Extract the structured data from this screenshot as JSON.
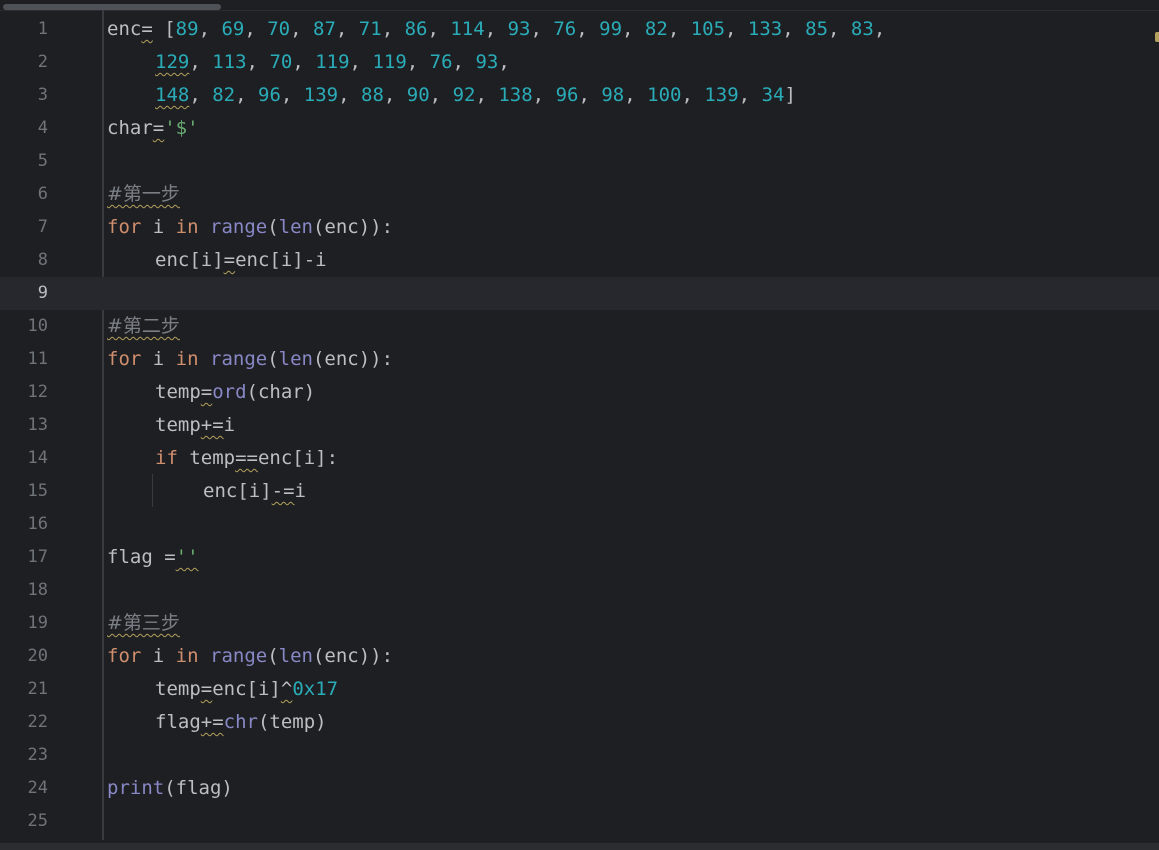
{
  "editor": {
    "lines": [
      {
        "n": "1",
        "t": [
          {
            "v": "enc",
            "c": ""
          },
          {
            "v": "=",
            "c": "",
            "w": true
          },
          {
            "v": " [",
            "c": ""
          },
          {
            "v": "89",
            "c": "num"
          },
          {
            "v": ", ",
            "c": ""
          },
          {
            "v": "69",
            "c": "num"
          },
          {
            "v": ", ",
            "c": ""
          },
          {
            "v": "70",
            "c": "num"
          },
          {
            "v": ", ",
            "c": ""
          },
          {
            "v": "87",
            "c": "num"
          },
          {
            "v": ", ",
            "c": ""
          },
          {
            "v": "71",
            "c": "num"
          },
          {
            "v": ", ",
            "c": ""
          },
          {
            "v": "86",
            "c": "num"
          },
          {
            "v": ", ",
            "c": ""
          },
          {
            "v": "114",
            "c": "num"
          },
          {
            "v": ", ",
            "c": ""
          },
          {
            "v": "93",
            "c": "num"
          },
          {
            "v": ", ",
            "c": ""
          },
          {
            "v": "76",
            "c": "num"
          },
          {
            "v": ", ",
            "c": ""
          },
          {
            "v": "99",
            "c": "num"
          },
          {
            "v": ", ",
            "c": ""
          },
          {
            "v": "82",
            "c": "num"
          },
          {
            "v": ", ",
            "c": ""
          },
          {
            "v": "105",
            "c": "num"
          },
          {
            "v": ", ",
            "c": ""
          },
          {
            "v": "133",
            "c": "num"
          },
          {
            "v": ", ",
            "c": ""
          },
          {
            "v": "85",
            "c": "num"
          },
          {
            "v": ", ",
            "c": ""
          },
          {
            "v": "83",
            "c": "num"
          },
          {
            "v": ",",
            "c": ""
          }
        ]
      },
      {
        "n": "2",
        "i": 1,
        "t": [
          {
            "v": "129",
            "c": "num",
            "w": true
          },
          {
            "v": ", ",
            "c": ""
          },
          {
            "v": "113",
            "c": "num"
          },
          {
            "v": ", ",
            "c": ""
          },
          {
            "v": "70",
            "c": "num"
          },
          {
            "v": ", ",
            "c": ""
          },
          {
            "v": "119",
            "c": "num"
          },
          {
            "v": ", ",
            "c": ""
          },
          {
            "v": "119",
            "c": "num"
          },
          {
            "v": ", ",
            "c": ""
          },
          {
            "v": "76",
            "c": "num"
          },
          {
            "v": ", ",
            "c": ""
          },
          {
            "v": "93",
            "c": "num"
          },
          {
            "v": ",",
            "c": ""
          }
        ]
      },
      {
        "n": "3",
        "i": 1,
        "t": [
          {
            "v": "148",
            "c": "num",
            "w": true
          },
          {
            "v": ", ",
            "c": ""
          },
          {
            "v": "82",
            "c": "num"
          },
          {
            "v": ", ",
            "c": ""
          },
          {
            "v": "96",
            "c": "num"
          },
          {
            "v": ", ",
            "c": ""
          },
          {
            "v": "139",
            "c": "num"
          },
          {
            "v": ", ",
            "c": ""
          },
          {
            "v": "88",
            "c": "num"
          },
          {
            "v": ", ",
            "c": ""
          },
          {
            "v": "90",
            "c": "num"
          },
          {
            "v": ", ",
            "c": ""
          },
          {
            "v": "92",
            "c": "num"
          },
          {
            "v": ", ",
            "c": ""
          },
          {
            "v": "138",
            "c": "num"
          },
          {
            "v": ", ",
            "c": ""
          },
          {
            "v": "96",
            "c": "num"
          },
          {
            "v": ", ",
            "c": ""
          },
          {
            "v": "98",
            "c": "num"
          },
          {
            "v": ", ",
            "c": ""
          },
          {
            "v": "100",
            "c": "num"
          },
          {
            "v": ", ",
            "c": ""
          },
          {
            "v": "139",
            "c": "num"
          },
          {
            "v": ", ",
            "c": ""
          },
          {
            "v": "34",
            "c": "num"
          },
          {
            "v": "]",
            "c": ""
          }
        ]
      },
      {
        "n": "4",
        "t": [
          {
            "v": "char",
            "c": ""
          },
          {
            "v": "=",
            "c": "",
            "w": true
          },
          {
            "v": "'$'",
            "c": "str"
          }
        ]
      },
      {
        "n": "5",
        "t": []
      },
      {
        "n": "6",
        "t": [
          {
            "v": "#第一步",
            "c": "cm",
            "w": true
          }
        ]
      },
      {
        "n": "7",
        "t": [
          {
            "v": "for",
            "c": "kw"
          },
          {
            "v": " i ",
            "c": ""
          },
          {
            "v": "in",
            "c": "kw"
          },
          {
            "v": " ",
            "c": ""
          },
          {
            "v": "range",
            "c": "bi"
          },
          {
            "v": "(",
            "c": ""
          },
          {
            "v": "len",
            "c": "bi"
          },
          {
            "v": "(enc)):",
            "c": ""
          }
        ]
      },
      {
        "n": "8",
        "i": 1,
        "t": [
          {
            "v": "enc[i]",
            "c": ""
          },
          {
            "v": "=",
            "c": "",
            "w": true
          },
          {
            "v": "enc[i]-i",
            "c": ""
          }
        ]
      },
      {
        "n": "9",
        "current": true,
        "t": []
      },
      {
        "n": "10",
        "t": [
          {
            "v": "#第二步",
            "c": "cm",
            "w": true
          }
        ]
      },
      {
        "n": "11",
        "t": [
          {
            "v": "for",
            "c": "kw"
          },
          {
            "v": " i ",
            "c": ""
          },
          {
            "v": "in",
            "c": "kw"
          },
          {
            "v": " ",
            "c": ""
          },
          {
            "v": "range",
            "c": "bi"
          },
          {
            "v": "(",
            "c": ""
          },
          {
            "v": "len",
            "c": "bi"
          },
          {
            "v": "(enc)):",
            "c": ""
          }
        ]
      },
      {
        "n": "12",
        "i": 1,
        "t": [
          {
            "v": "temp",
            "c": ""
          },
          {
            "v": "=",
            "c": "",
            "w": true
          },
          {
            "v": "ord",
            "c": "bi"
          },
          {
            "v": "(char)",
            "c": ""
          }
        ]
      },
      {
        "n": "13",
        "i": 1,
        "t": [
          {
            "v": "temp",
            "c": ""
          },
          {
            "v": "+=",
            "c": "",
            "w": true
          },
          {
            "v": "i",
            "c": ""
          }
        ]
      },
      {
        "n": "14",
        "i": 1,
        "t": [
          {
            "v": "if",
            "c": "kw"
          },
          {
            "v": " temp",
            "c": ""
          },
          {
            "v": "==",
            "c": "",
            "w": true
          },
          {
            "v": "enc[i]:",
            "c": ""
          }
        ]
      },
      {
        "n": "15",
        "i": 2,
        "t": [
          {
            "v": "enc[i]",
            "c": ""
          },
          {
            "v": "-=",
            "c": "",
            "w": true
          },
          {
            "v": "i",
            "c": ""
          }
        ]
      },
      {
        "n": "16",
        "t": []
      },
      {
        "n": "17",
        "t": [
          {
            "v": "flag ",
            "c": ""
          },
          {
            "v": "=",
            "c": ""
          },
          {
            "v": "''",
            "c": "str",
            "w": true
          }
        ]
      },
      {
        "n": "18",
        "t": []
      },
      {
        "n": "19",
        "t": [
          {
            "v": "#第三步",
            "c": "cm",
            "w": true
          }
        ]
      },
      {
        "n": "20",
        "t": [
          {
            "v": "for",
            "c": "kw"
          },
          {
            "v": " i ",
            "c": ""
          },
          {
            "v": "in",
            "c": "kw"
          },
          {
            "v": " ",
            "c": ""
          },
          {
            "v": "range",
            "c": "bi"
          },
          {
            "v": "(",
            "c": ""
          },
          {
            "v": "len",
            "c": "bi"
          },
          {
            "v": "(enc)):",
            "c": ""
          }
        ]
      },
      {
        "n": "21",
        "i": 1,
        "t": [
          {
            "v": "temp",
            "c": ""
          },
          {
            "v": "=",
            "c": "",
            "w": true
          },
          {
            "v": "enc[i]",
            "c": ""
          },
          {
            "v": "^",
            "c": "",
            "w": true
          },
          {
            "v": "0x17",
            "c": "num"
          }
        ]
      },
      {
        "n": "22",
        "i": 1,
        "t": [
          {
            "v": "flag",
            "c": ""
          },
          {
            "v": "+=",
            "c": "",
            "w": true
          },
          {
            "v": "chr",
            "c": "bi"
          },
          {
            "v": "(temp)",
            "c": ""
          }
        ]
      },
      {
        "n": "23",
        "t": []
      },
      {
        "n": "24",
        "t": [
          {
            "v": "print",
            "c": "bi"
          },
          {
            "v": "(flag)",
            "c": ""
          }
        ]
      },
      {
        "n": "25",
        "t": []
      }
    ]
  }
}
